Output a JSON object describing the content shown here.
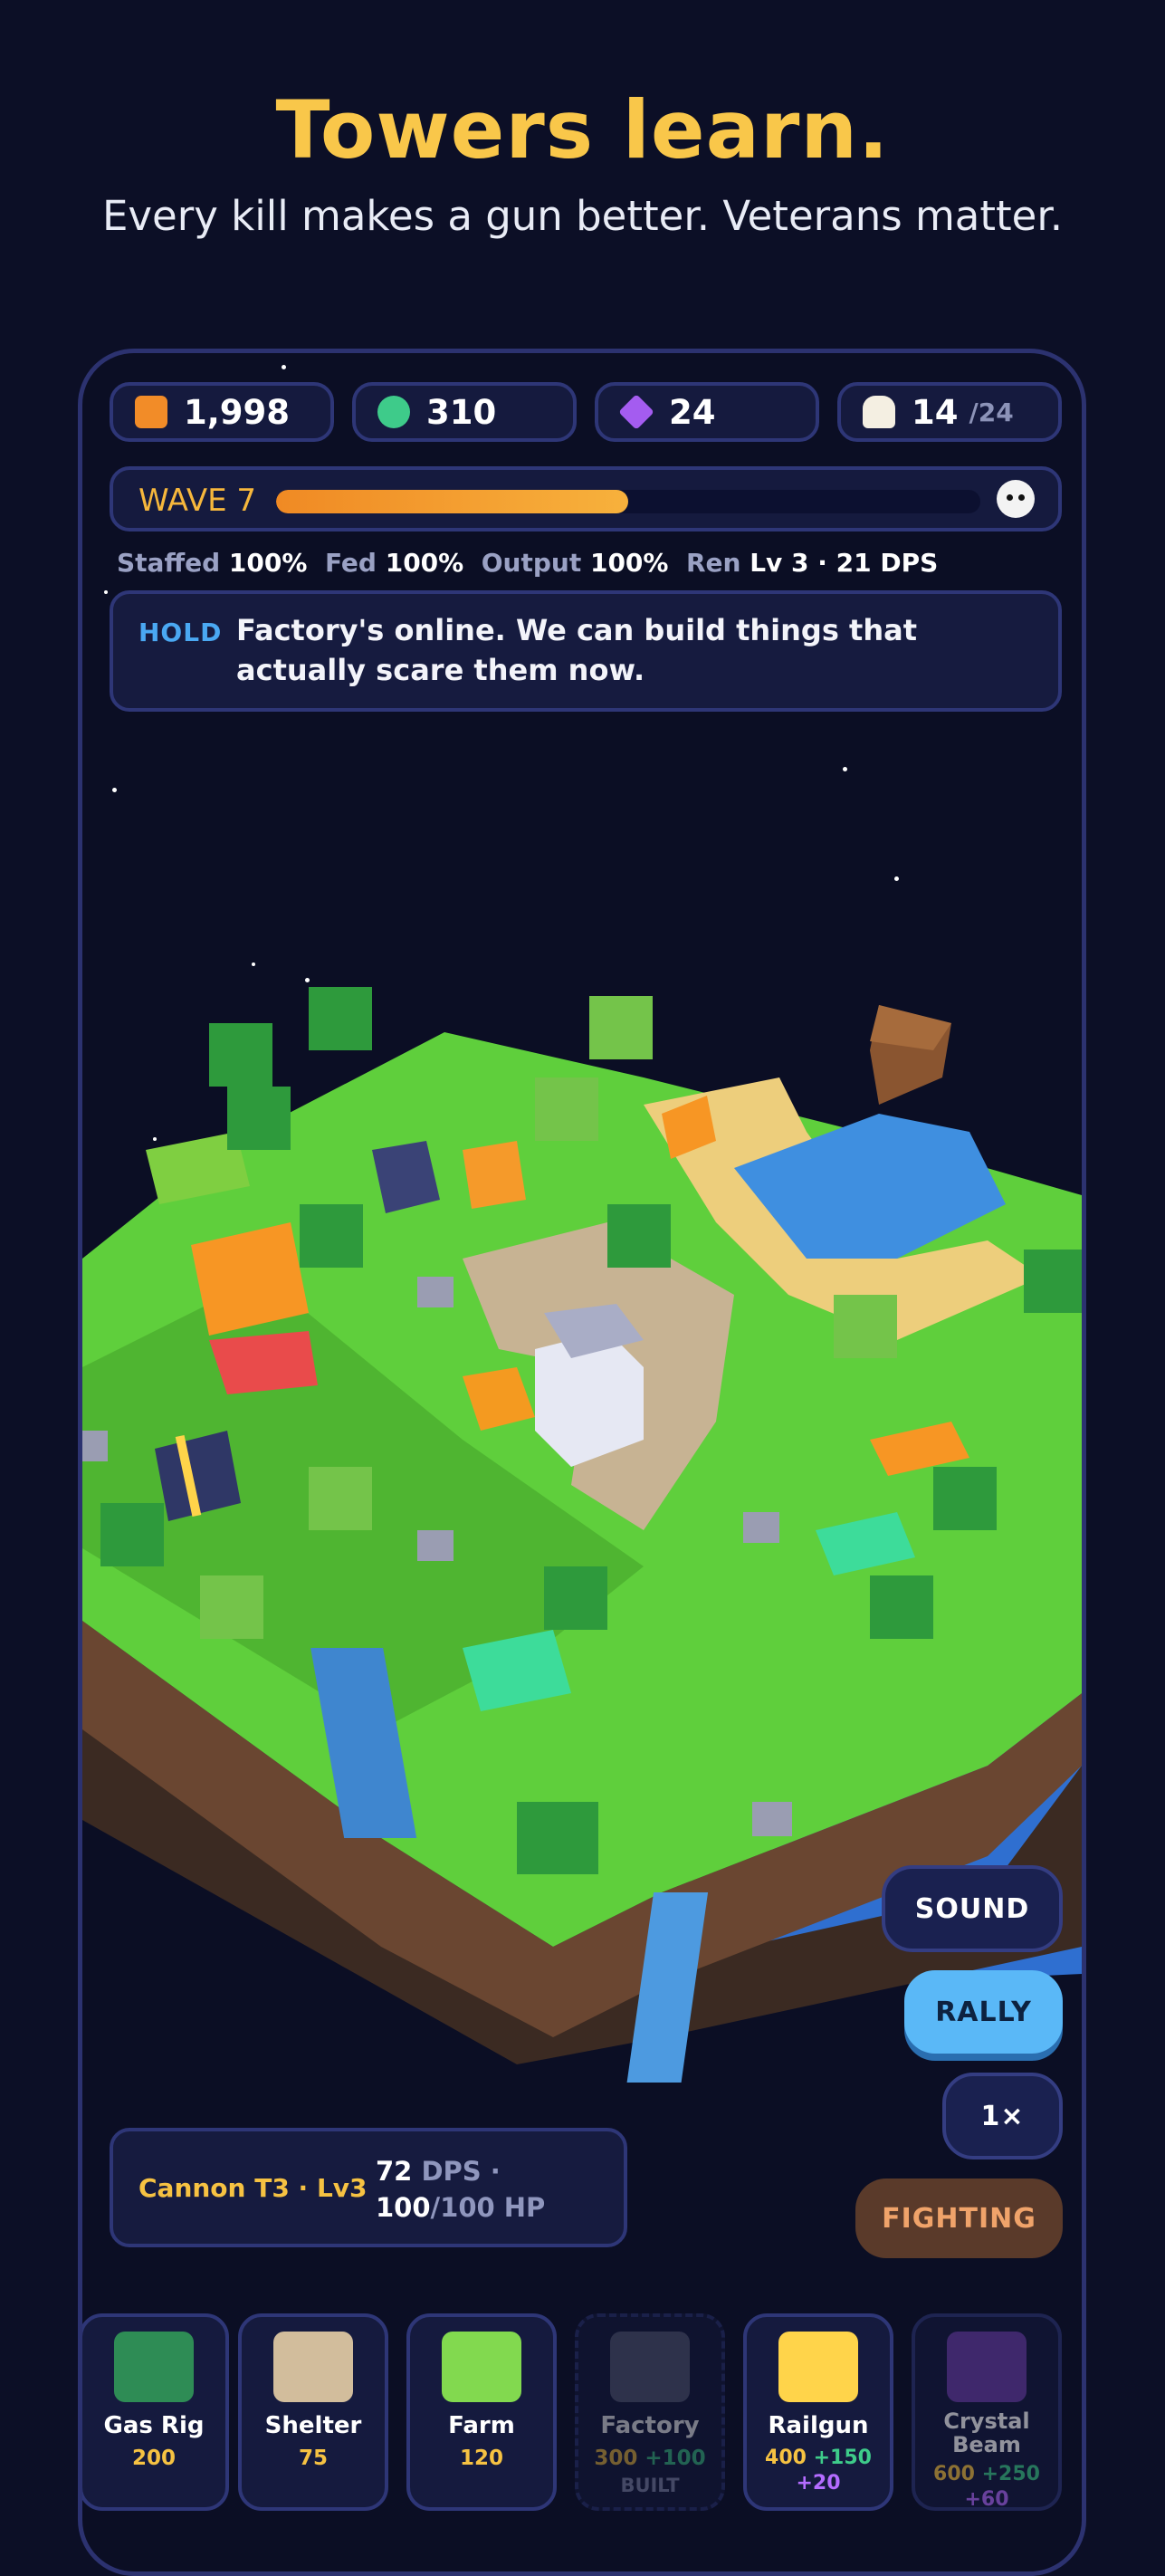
{
  "headline": "Towers learn.",
  "subheadline": "Every kill makes a gun better. Veterans matter.",
  "resources": {
    "ore": {
      "value": "1,998",
      "color": "#f28c28",
      "icon": "ore-cube-icon"
    },
    "gas": {
      "value": "310",
      "color": "#3ecb8a",
      "icon": "gas-orb-icon"
    },
    "crystal": {
      "value": "24",
      "color": "#a45cf0",
      "icon": "crystal-diamond-icon"
    },
    "population": {
      "value": "14",
      "capacity": "/24",
      "color": "#f4efe2",
      "icon": "population-icon"
    }
  },
  "wave": {
    "label": "WAVE 7",
    "progress": 0.5,
    "icon": "skull-icon"
  },
  "stats": {
    "staffed_label": "Staffed",
    "staffed_value": "100%",
    "fed_label": "Fed",
    "fed_value": "100%",
    "output_label": "Output",
    "output_value": "100%",
    "ren_label": "Ren",
    "ren_value": "Lv 3 · 21 DPS"
  },
  "message": {
    "tag": "HOLD",
    "text": "Factory's online. We can build things that actually scare them now."
  },
  "controls": {
    "sound": "SOUND",
    "rally": "RALLY",
    "speed": "1×",
    "status": "FIGHTING"
  },
  "selected_tower": {
    "name": "Cannon T3 · Lv3",
    "dps": "72",
    "dps_label": "DPS ·",
    "hp": "100",
    "hp_max": "/100 HP"
  },
  "build_menu": [
    {
      "name": "Gas Rig",
      "cost": "200",
      "color": "#2e8c55"
    },
    {
      "name": "Shelter",
      "cost": "75",
      "color": "#d2bd9c"
    },
    {
      "name": "Farm",
      "cost": "120",
      "color": "#82d94f"
    },
    {
      "name": "Factory",
      "cost_a": "300",
      "cost_b": "+100",
      "status": "BUILT",
      "color": "#5a5f7c"
    },
    {
      "name": "Railgun",
      "cost_a": "400",
      "cost_b": "+150",
      "cost_c": "+20",
      "color": "#ffd44a"
    },
    {
      "name": "Crystal Beam",
      "cost_a": "600",
      "cost_b": "+250",
      "cost_c": "+60",
      "color": "#6a3fa8"
    }
  ]
}
